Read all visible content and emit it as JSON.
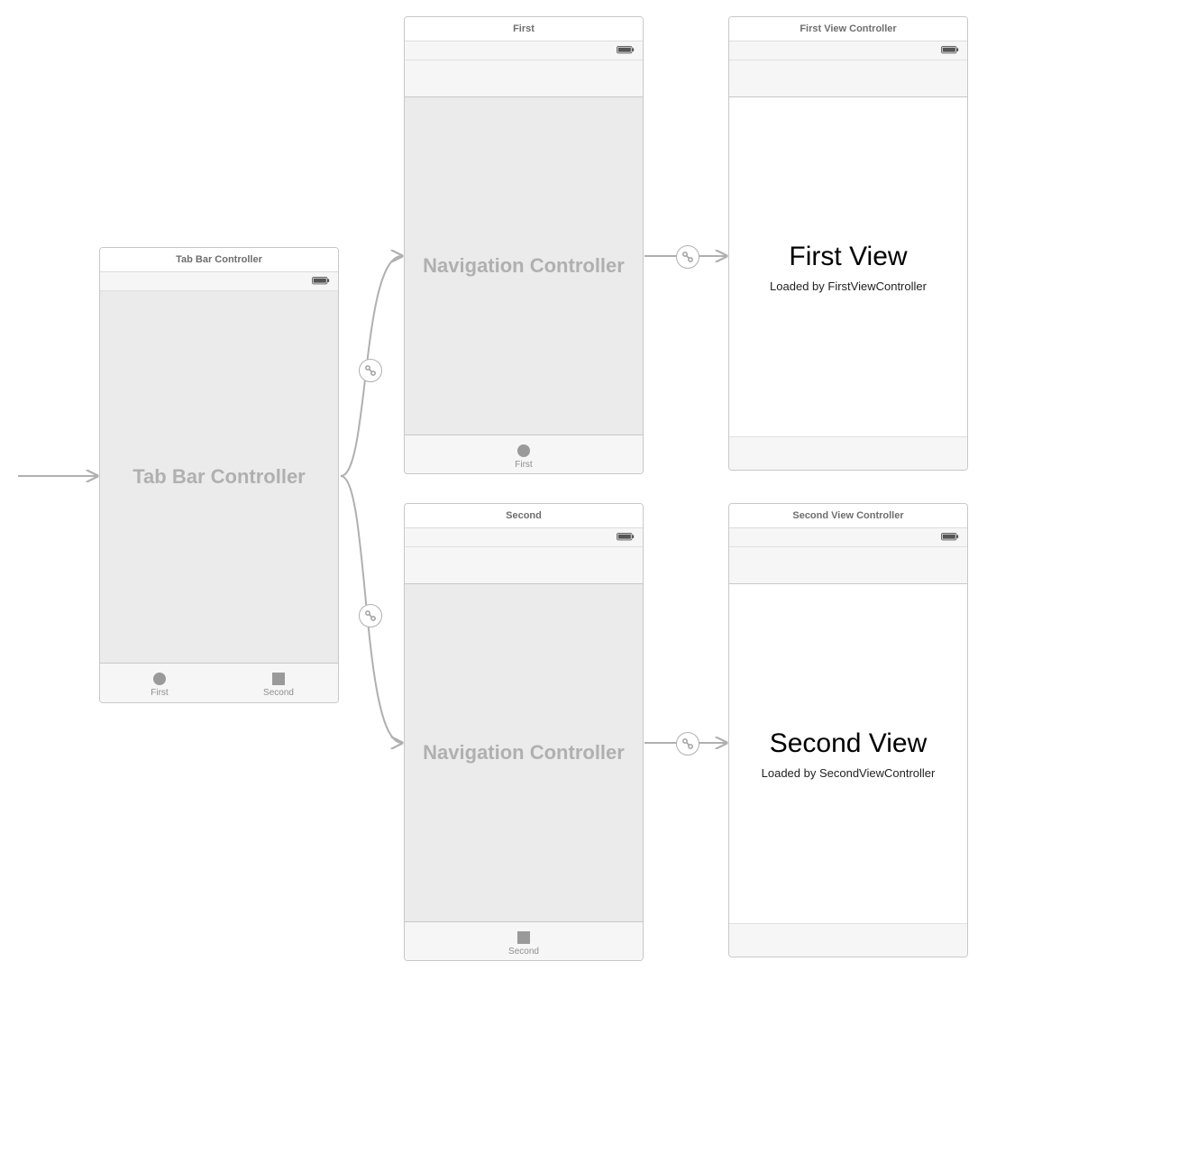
{
  "scenes": {
    "tabBar": {
      "title": "Tab Bar Controller",
      "bigLabel": "Tab Bar Controller",
      "tabs": [
        {
          "label": "First",
          "iconShape": "circle"
        },
        {
          "label": "Second",
          "iconShape": "square"
        }
      ]
    },
    "navFirst": {
      "title": "First",
      "bigLabel": "Navigation Controller",
      "tab": {
        "label": "First",
        "iconShape": "circle"
      }
    },
    "navSecond": {
      "title": "Second",
      "bigLabel": "Navigation Controller",
      "tab": {
        "label": "Second",
        "iconShape": "square"
      }
    },
    "viewFirst": {
      "title": "First View Controller",
      "heading": "First View",
      "subtitle": "Loaded by FirstViewController"
    },
    "viewSecond": {
      "title": "Second View Controller",
      "heading": "Second View",
      "subtitle": "Loaded by SecondViewController"
    }
  }
}
